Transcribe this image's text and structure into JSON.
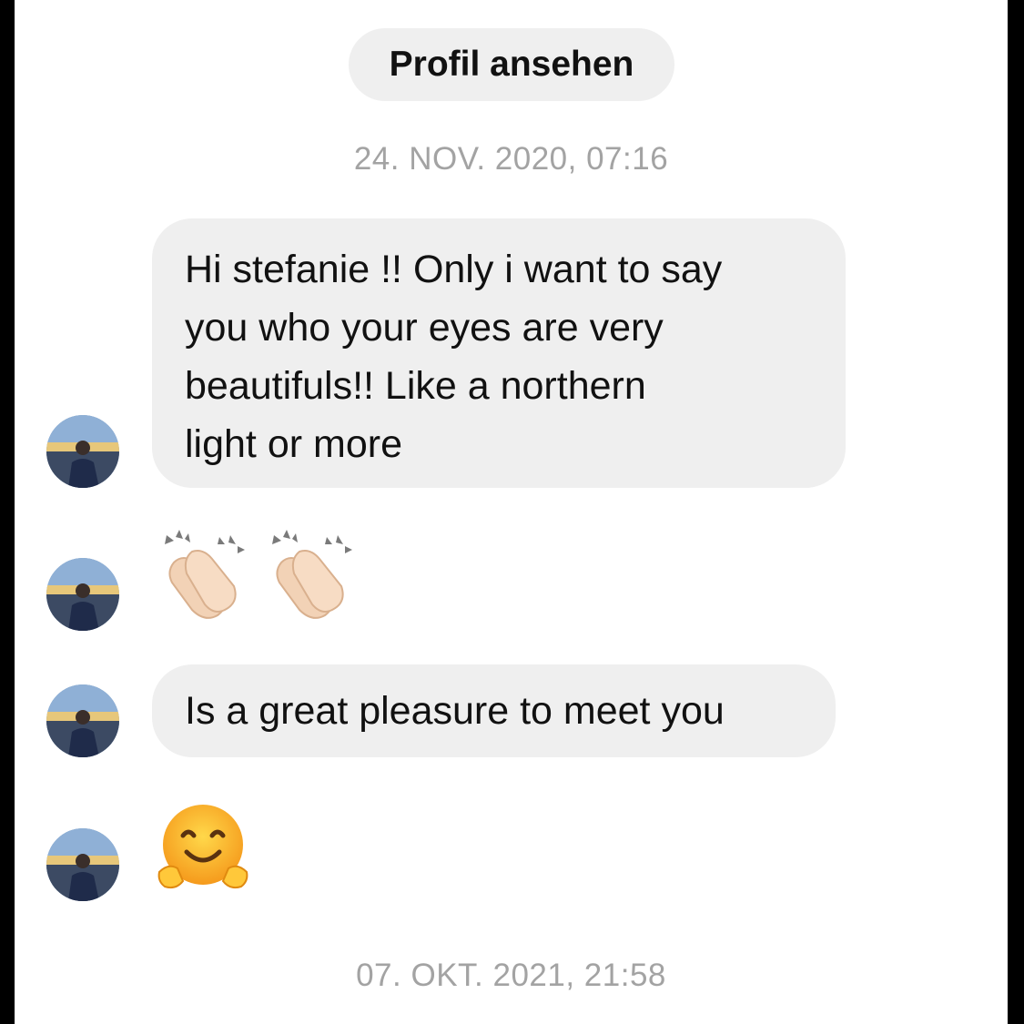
{
  "header": {
    "profile_button_label": "Profil ansehen"
  },
  "timestamps": [
    "24. NOV. 2020, 07:16",
    "07. OKT. 2021, 21:58"
  ],
  "messages": [
    {
      "type": "text",
      "lines": [
        "Hi stefanie !! Only i want to say",
        "you who your eyes are very",
        "beautifuls!! Like a northern",
        "light or more"
      ]
    },
    {
      "type": "emoji",
      "icons": [
        "clapping-hands-icon",
        "clapping-hands-icon"
      ]
    },
    {
      "type": "text",
      "lines": [
        "Is a great pleasure to meet you"
      ]
    },
    {
      "type": "emoji",
      "icons": [
        "hugging-face-icon"
      ]
    }
  ],
  "colors": {
    "bubble": "#efefef",
    "timestamp": "#a3a3a3",
    "text": "#111111"
  }
}
